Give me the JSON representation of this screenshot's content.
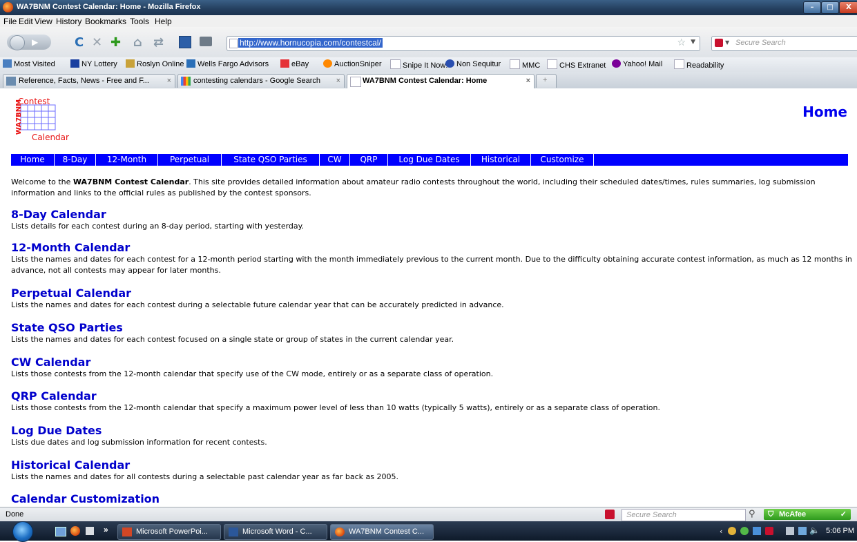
{
  "window": {
    "title": "WA7BNM Contest Calendar: Home - Mozilla Firefox",
    "minimize": "–",
    "maximize": "□",
    "close": "X"
  },
  "menu": [
    "File",
    "Edit",
    "View",
    "History",
    "Bookmarks",
    "Tools",
    "Help"
  ],
  "toolbar": {
    "url": "http://www.hornucopia.com/contestcal/",
    "search_placeholder": "Secure Search"
  },
  "bookmarks": [
    {
      "label": "Most Visited",
      "color": "#4a7fc0"
    },
    {
      "label": "NY Lottery",
      "color": "#1a3fa0"
    },
    {
      "label": "Roslyn Online",
      "color": "#c9a23a"
    },
    {
      "label": "Wells Fargo Advisors",
      "color": "#2a6fb8"
    },
    {
      "label": "eBay",
      "color": "#e53238"
    },
    {
      "label": "AuctionSniper",
      "color": "#ff8800"
    },
    {
      "label": "Snipe It Now!",
      "color": "#dddddd"
    },
    {
      "label": "Non Sequitur",
      "color": "#2a4fb0"
    },
    {
      "label": "MMC",
      "color": "#dddddd"
    },
    {
      "label": "CHS Extranet",
      "color": "#dddddd"
    },
    {
      "label": "Yahoo! Mail",
      "color": "#7b0099"
    },
    {
      "label": "Readability",
      "color": "#dddddd"
    }
  ],
  "tabs": [
    {
      "label": "Reference, Facts, News - Free and F...",
      "close": "×"
    },
    {
      "label": "contesting calendars - Google Search",
      "close": "×"
    },
    {
      "label": "WA7BNM Contest Calendar: Home",
      "close": "×"
    },
    {
      "label": "+"
    }
  ],
  "page": {
    "logo": {
      "top": "Contest",
      "side": "WA7BNM",
      "bottom": "Calendar"
    },
    "heading": "Home",
    "nav": [
      "Home",
      "8-Day",
      "12-Month",
      "Perpetual",
      "State QSO Parties",
      "CW",
      "QRP",
      "Log Due Dates",
      "Historical",
      "Customize"
    ],
    "intro": {
      "pre": "Welcome to the ",
      "bold": "WA7BNM Contest Calendar",
      "post": ". This site provides detailed information about amateur radio contests throughout the world, including their scheduled dates/times, rules summaries, log submission information and links to the official rules as published by the contest sponsors."
    },
    "sections": [
      {
        "title": "8-Day Calendar",
        "desc": "Lists details for each contest during an 8-day period, starting with yesterday."
      },
      {
        "title": "12-Month Calendar",
        "desc": "Lists the names and dates for each contest for a 12-month period starting with the month immediately previous to the current month. Due to the difficulty obtaining accurate contest information, as much as 12 months in advance, not all contests may appear for later months."
      },
      {
        "title": "Perpetual Calendar",
        "desc": "Lists the names and dates for each contest during a selectable future calendar year that can be accurately predicted in advance."
      },
      {
        "title": "State QSO Parties",
        "desc": "Lists the names and dates for each contest focused on a single state or group of states in the current calendar year."
      },
      {
        "title": "CW Calendar",
        "desc": "Lists those contests from the 12-month calendar that specify use of the CW mode, entirely or as a separate class of operation."
      },
      {
        "title": "QRP Calendar",
        "desc": "Lists those contests from the 12-month calendar that specify a maximum power level of less than 10 watts (typically 5 watts), entirely or as a separate class of operation."
      },
      {
        "title": "Log Due Dates",
        "desc": "Lists due dates and log submission information for recent contests."
      },
      {
        "title": "Historical Calendar",
        "desc": "Lists the names and dates for all contests during a selectable past calendar year as far back as 2005."
      },
      {
        "title": "Calendar Customization",
        "desc": ""
      }
    ]
  },
  "status": {
    "text": "Done",
    "search_placeholder": "Secure Search",
    "mcafee": "McAfee"
  },
  "taskbar": {
    "overflow": "»",
    "buttons": [
      "Microsoft PowerPoi...",
      "Microsoft Word - C...",
      "WA7BNM Contest C..."
    ],
    "clock": "5:06 PM"
  }
}
